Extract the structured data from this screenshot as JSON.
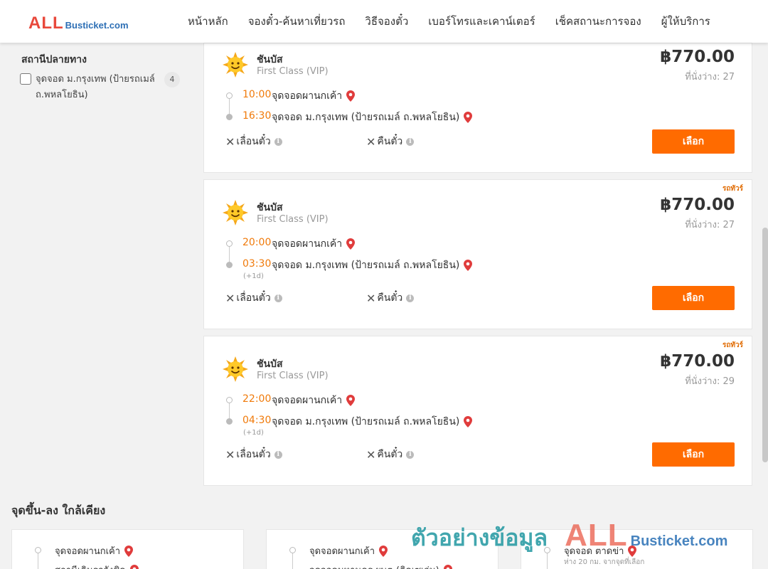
{
  "header": {
    "logo_main": "ALL",
    "logo_rest": "Busticket.com",
    "nav": [
      "หน้าหลัก",
      "จองตั๋ว-ค้นหาเที่ยวรถ",
      "วิธีจองตั๋ว",
      "เบอร์โทรและเคาน์เตอร์",
      "เช็คสถานะการจอง",
      "ผู้ให้บริการ"
    ]
  },
  "filter": {
    "title": "สถานีปลายทาง",
    "option_label": "จุดจอด ม.กรุงเทพ (ป้ายรถเมล์ ถ.พหลโยธิน)",
    "option_count": "4"
  },
  "trips": [
    {
      "operator": "ชันบัส",
      "bus_class": "First Class (VIP)",
      "price": "฿770.00",
      "seats": "ที่นั่งว่าง: 27",
      "badge": "",
      "depart_time": "10:00",
      "depart_stop": "จุดจอดผานกเค้า",
      "arrive_time": "16:30",
      "arrive_stop": "จุดจอด ม.กรุงเทพ (ป้ายรถเมล์ ถ.พหลโยธิน)",
      "next_day": "",
      "reschedule": "เลื่อนตั๋ว",
      "refund": "คืนตั๋ว",
      "select": "เลือก"
    },
    {
      "operator": "ชันบัส",
      "bus_class": "First Class (VIP)",
      "price": "฿770.00",
      "seats": "ที่นั่งว่าง: 27",
      "badge": "รถทัวร์",
      "depart_time": "20:00",
      "depart_stop": "จุดจอดผานกเค้า",
      "arrive_time": "03:30",
      "arrive_stop": "จุดจอด ม.กรุงเทพ (ป้ายรถเมล์ ถ.พหลโยธิน)",
      "next_day": "(+1d)",
      "reschedule": "เลื่อนตั๋ว",
      "refund": "คืนตั๋ว",
      "select": "เลือก"
    },
    {
      "operator": "ชันบัส",
      "bus_class": "First Class (VIP)",
      "price": "฿770.00",
      "seats": "ที่นั่งว่าง: 29",
      "badge": "รถทัวร์",
      "depart_time": "22:00",
      "depart_stop": "จุดจอดผานกเค้า",
      "arrive_time": "04:30",
      "arrive_stop": "จุดจอด ม.กรุงเทพ (ป้ายรถเมล์ ถ.พหลโยธิน)",
      "next_day": "(+1d)",
      "reschedule": "เลื่อนตั๋ว",
      "refund": "คืนตั๋ว",
      "select": "เลือก"
    }
  ],
  "nearby": {
    "title": "จุดขึ้น-ลง ใกล้เคียง",
    "cards": [
      {
        "stop1": "จุดจอดผานกเค้า",
        "stop2": "สถานีเดินรถวังชิด",
        "dist": ""
      },
      {
        "stop1": "จุดจอดผานกเค้า",
        "stop2": "จุดจอดมหานคร ผษต (ติดเซเว่น)",
        "dist": ""
      },
      {
        "stop1": "จุดจอด ตาดข่า",
        "stop2": "",
        "dist": "ห่าง 20 กม. จากจุดที่เลือก"
      }
    ]
  },
  "watermark": {
    "text": "ตัวอย่างข้อมูล",
    "logo_main": "ALL",
    "logo_rest": "Busticket.com"
  },
  "colors": {
    "accent": "#ff6b00",
    "time": "#f07a0a",
    "pin": "#e03c3c",
    "logo_red": "#e8483b",
    "logo_blue": "#2d6fb5"
  }
}
